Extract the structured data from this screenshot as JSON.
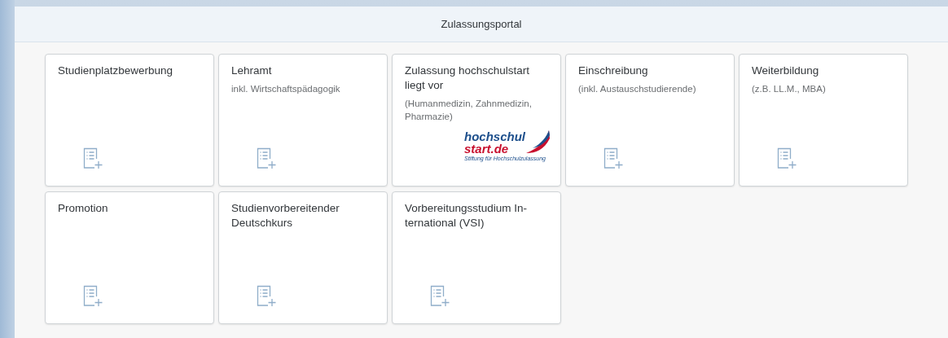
{
  "header": {
    "title": "Zulassungsportal"
  },
  "tiles": [
    {
      "kind": "icon",
      "title": "Studienplatzbewerbung"
    },
    {
      "kind": "icon",
      "title": "Lehramt",
      "subtitle": "inkl. Wirtschaftspädagogik"
    },
    {
      "kind": "logo",
      "title": "Zulassung hochschulstart liegt vor",
      "subtitle": "(Humanmedizin, Zahnmedizin, Pharmazie)",
      "logo": {
        "line_1": "hochschul",
        "line_2": "start.de",
        "tagline": "Stiftung für Hochschulzulassung"
      }
    },
    {
      "kind": "icon",
      "title": "Einschreibung",
      "subtitle": "(inkl. Austauschstudierende)"
    },
    {
      "kind": "icon",
      "title": "Weiterbildung",
      "subtitle": "(z.B. LL.M., MBA)"
    },
    {
      "kind": "icon",
      "title": "Promotion"
    },
    {
      "kind": "icon",
      "title": "Studienvorbereitender Deutschkurs"
    },
    {
      "kind": "icon",
      "title": "Vorbereitungsstudium In-ternational (VSI)"
    }
  ]
}
